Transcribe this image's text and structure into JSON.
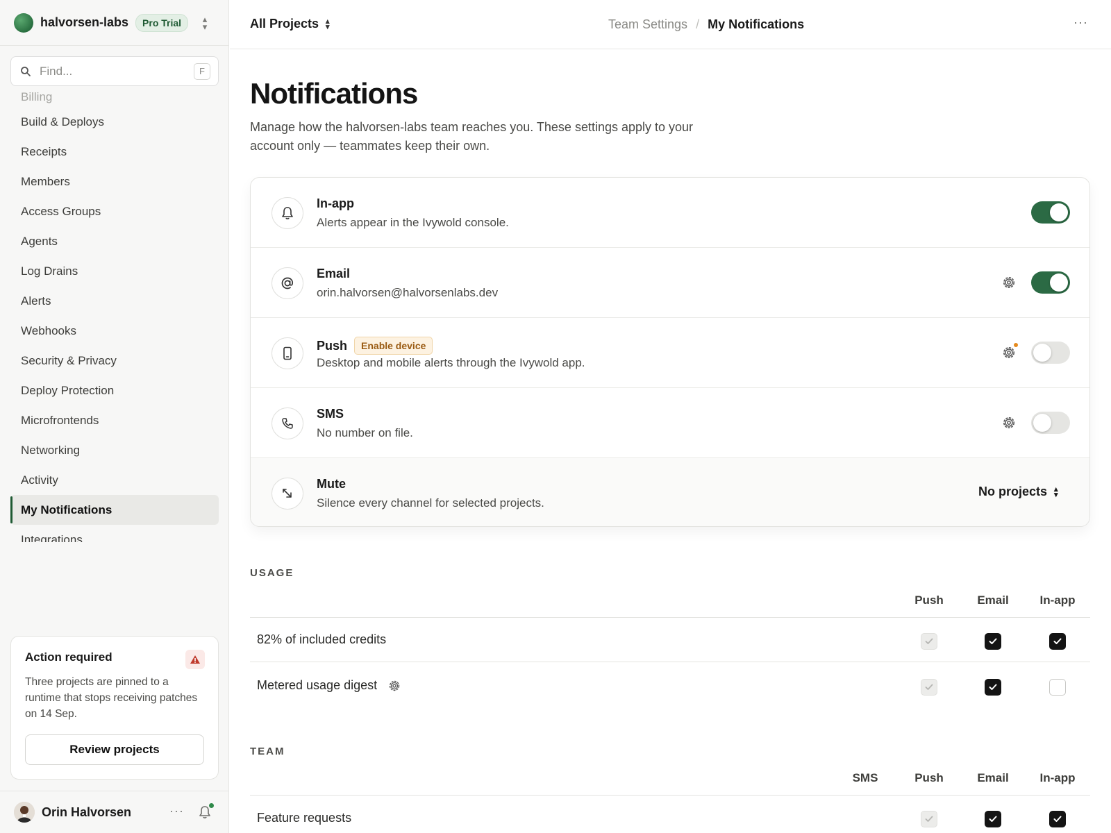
{
  "team": {
    "name": "halvorsen-labs",
    "plan": "Pro Trial"
  },
  "search": {
    "placeholder": "Find...",
    "shortcut": "F"
  },
  "sidebar": {
    "items": [
      {
        "label": "Billing",
        "state": "faded"
      },
      {
        "label": "Build & Deploys"
      },
      {
        "label": "Receipts"
      },
      {
        "label": "Members"
      },
      {
        "label": "Access Groups"
      },
      {
        "label": "Agents"
      },
      {
        "label": "Log Drains"
      },
      {
        "label": "Alerts"
      },
      {
        "label": "Webhooks"
      },
      {
        "label": "Security & Privacy"
      },
      {
        "label": "Deploy Protection"
      },
      {
        "label": "Microfrontends"
      },
      {
        "label": "Networking"
      },
      {
        "label": "Activity"
      },
      {
        "label": "My Notifications",
        "state": "active"
      },
      {
        "label": "Integrations"
      }
    ]
  },
  "action_card": {
    "title": "Action required",
    "text": "Three projects are pinned to a runtime that stops receiving patches on 14 Sep.",
    "button": "Review projects"
  },
  "user": {
    "name": "Orin Halvorsen",
    "more": "···"
  },
  "topbar": {
    "project_select": "All Projects",
    "breadcrumb": [
      "Team Settings",
      "My Notifications"
    ],
    "breadcrumb_sep": "/",
    "more": "···"
  },
  "page": {
    "title": "Notifications",
    "description": "Manage how the halvorsen-labs team reaches you. These settings apply to your account only — teammates keep their own."
  },
  "channels": [
    {
      "title": "In-app",
      "subtitle": "Alerts appear in the Ivywold console.",
      "icon": "bell-icon",
      "enabled": true
    },
    {
      "title": "Email",
      "subtitle": "orin.halvorsen@halvorsenlabs.dev",
      "icon": "at-sign-icon",
      "enabled": true
    },
    {
      "title": "Push",
      "badge": "Enable device",
      "subtitle": "Desktop and mobile alerts through the Ivywold app.",
      "icon": "phone-icon",
      "enabled": false
    },
    {
      "title": "SMS",
      "subtitle": "No number on file.",
      "icon": "telephone-icon",
      "enabled": false
    },
    {
      "title": "Mute",
      "subtitle": "Silence every channel for selected projects.",
      "icon": "mute-arrow-icon",
      "select": "No projects"
    }
  ],
  "usage": {
    "label": "USAGE",
    "columns": [
      "Push",
      "Email",
      "In-app"
    ],
    "rows": [
      {
        "label": "82% of included credits",
        "values": [
          "disabled",
          "checked",
          "checked"
        ]
      },
      {
        "label": "Metered usage digest",
        "values": [
          "disabled",
          "checked",
          "empty"
        ]
      }
    ]
  },
  "team_section": {
    "label": "TEAM",
    "columns": [
      "SMS",
      "Push",
      "Email",
      "In-app"
    ],
    "rows": [
      {
        "label": "Feature requests",
        "values": [
          "none",
          "disabled",
          "checked",
          "checked"
        ]
      }
    ]
  },
  "colors": {
    "accent": "#2b6a44",
    "badge_warn": "#9a5b12",
    "danger": "#c0392b"
  }
}
